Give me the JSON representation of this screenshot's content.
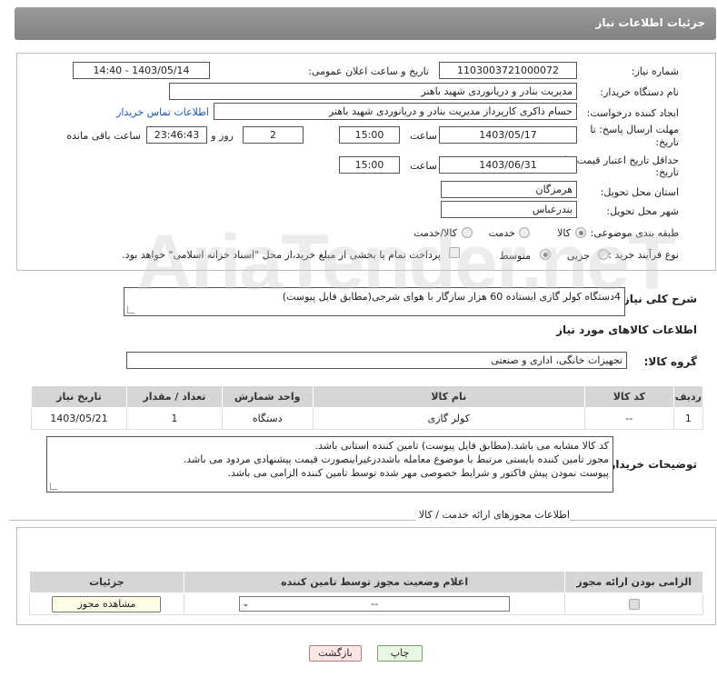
{
  "header": {
    "title": "جزئیات اطلاعات نیاز"
  },
  "form": {
    "need_number_label": "شماره نیاز:",
    "need_number": "1103003721000072",
    "announce_datetime_label": "تاریخ و ساعت اعلان عمومی:",
    "announce_datetime": "1403/05/14 - 14:40",
    "buyer_org_label": "نام دستگاه خریدار:",
    "buyer_org": "مدیریت بنادر و دریانوردی شهید باهنر",
    "requester_label": "ایجاد کننده درخواست:",
    "requester": "حسام  ذاکری کارپرداز مدیریت بنادر و دریانوردی شهید باهنر",
    "buyer_contact_link": "اطلاعات تماس خریدار",
    "deadline_label_1": "مهلت ارسال پاسخ: تا",
    "deadline_label_2": "تاریخ:",
    "deadline_date": "1403/05/17",
    "time_label": "ساعت",
    "deadline_time": "15:00",
    "days_count": "2",
    "days_label": "روز و",
    "remaining_time": "23:46:43",
    "remaining_label": "ساعت باقی مانده",
    "validity_label_1": "حداقل تاریخ اعتبار قیمت: تا",
    "validity_label_2": "تاریخ:",
    "validity_date": "1403/06/31",
    "validity_time": "15:00",
    "province_label": "استان محل تحویل:",
    "province": "هرمزگان",
    "city_label": "شهر محل تحویل:",
    "city": "بندرعباس",
    "category_label": "طبقه بندی موضوعی:",
    "category_options": [
      "کالا",
      "خدمت",
      "کالا/خدمت"
    ],
    "purchase_type_label": "نوع فرآیند خرید :",
    "purchase_options": [
      "جزیی",
      "متوسط"
    ],
    "payment_note": "پرداخت تمام یا بخشی از مبلغ خرید،از محل \"اسناد خزانه اسلامی\" خواهد بود."
  },
  "description": {
    "label": "شرح کلی نیاز:",
    "text": "4دستگاه کولر گازی ایستاده 60 هزار سازگار با هوای شرجی(مطابق فایل پیوست)"
  },
  "goods_info": {
    "title": "اطلاعات کالاهای مورد نیاز",
    "group_label": "گروه کالا:",
    "group_value": "تجهیزات خانگی، اداری و صنعتی",
    "columns": [
      "ردیف",
      "کد کالا",
      "نام کالا",
      "واحد شمارش",
      "تعداد / مقدار",
      "تاریخ نیاز"
    ],
    "rows": [
      [
        "1",
        "--",
        "کولر گازی",
        "دستگاه",
        "1",
        "1403/05/21"
      ]
    ]
  },
  "buyer_notes": {
    "label": "توضیحات خریدار:",
    "lines": [
      "کد کالا مشابه می باشد.(مطابق فایل پیوست) تامین کننده استانی باشد.",
      "مجوز تامین کننده بایستی مرتبط با موضوع معامله باشددرغیراینصورت قیمت پیشنهادی مردود  می باشد.",
      "پیوست نمودن پیش فاکتور و شرایط خصوصی مهر شده توسط تامین کننده الزامی می باشد."
    ]
  },
  "permits": {
    "title": "اطلاعات مجوزهای ارائه خدمت / کالا",
    "columns": [
      "الزامی بودن ارائه مجوز",
      "اعلام وضعیت مجوز توسط تامین کننده",
      "جزئیات"
    ],
    "select_value": "--",
    "view_button": "مشاهده مجوز"
  },
  "footer": {
    "print_button": "چاپ",
    "back_button": "بازگشت"
  },
  "watermark": "AriaTender.net"
}
